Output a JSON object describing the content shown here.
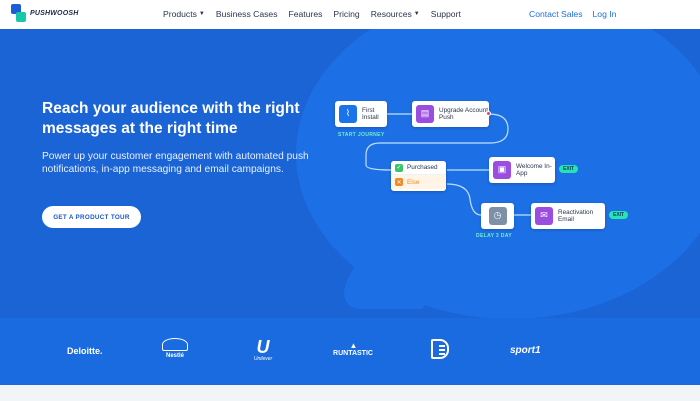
{
  "brand": {
    "name": "PUSHWOOSH",
    "logo_icon": "pushwoosh-logo-icon"
  },
  "nav": {
    "links": [
      {
        "label": "Products",
        "caret": true
      },
      {
        "label": "Business Cases",
        "caret": false
      },
      {
        "label": "Features",
        "caret": false
      },
      {
        "label": "Pricing",
        "caret": false
      },
      {
        "label": "Resources",
        "caret": true
      },
      {
        "label": "Support",
        "caret": false
      }
    ],
    "contact_sales": "Contact Sales",
    "login": "Log In"
  },
  "hero": {
    "title": "Reach your audience with the right messages at the right time",
    "subtitle": "Power up your customer engagement with automated push notifications, in-app messaging and email campaigns.",
    "cta": "GET A PRODUCT TOUR"
  },
  "flow": {
    "first_install": "First Install",
    "start_journey": "START JOURNEY",
    "upgrade_push": "Upgrade Account Push",
    "purchased": "Purchased",
    "else": "Else",
    "welcome": "Welcome In-App",
    "delay": "DELAY 3 DAY",
    "reactivation": "Reactivation Email",
    "exit": "EXIT"
  },
  "logos": {
    "deloitte": "Deloitte.",
    "nestle": "Nestlé",
    "unilever": "Unilever",
    "runtastic": "RUNTASTIC",
    "sport1": "sport1"
  },
  "colors": {
    "hero_bg": "#1a64d6",
    "bubble": "#1d6fe5",
    "accent_green": "#27e3b2",
    "link_blue": "#1d6fe0"
  }
}
